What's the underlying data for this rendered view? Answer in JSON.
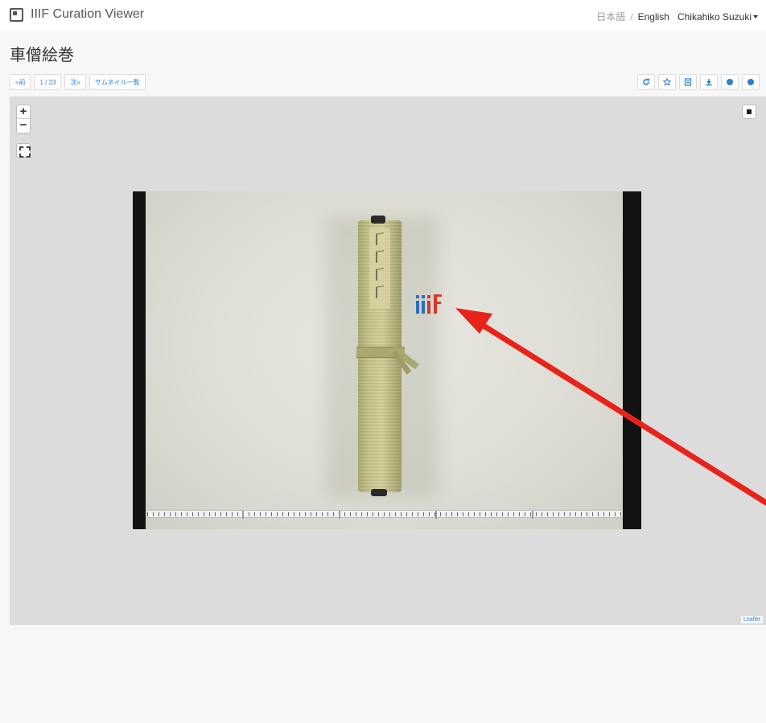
{
  "navbar": {
    "brand": "IIIF Curation Viewer",
    "lang_ja": "日本語",
    "lang_sep": "/",
    "lang_en": "English",
    "user": "Chikahiko Suzuki"
  },
  "page": {
    "title": "車僧絵巻"
  },
  "toolbar": {
    "prev_label": "«前",
    "page_counter": "1 / 23",
    "next_label": "次»",
    "thumbnails_label": "サムネイル一覧",
    "right_icons": [
      "rotate-icon",
      "star-icon",
      "list-icon",
      "download-icon",
      "info-icon",
      "help-icon"
    ]
  },
  "viewer": {
    "zoom_in": "+",
    "zoom_out": "−",
    "attribution": "Leaflet"
  },
  "colors": {
    "accent": "#2a7fd4",
    "annotation_arrow": "#e8231b",
    "viewer_bg": "#dcdcdc"
  }
}
